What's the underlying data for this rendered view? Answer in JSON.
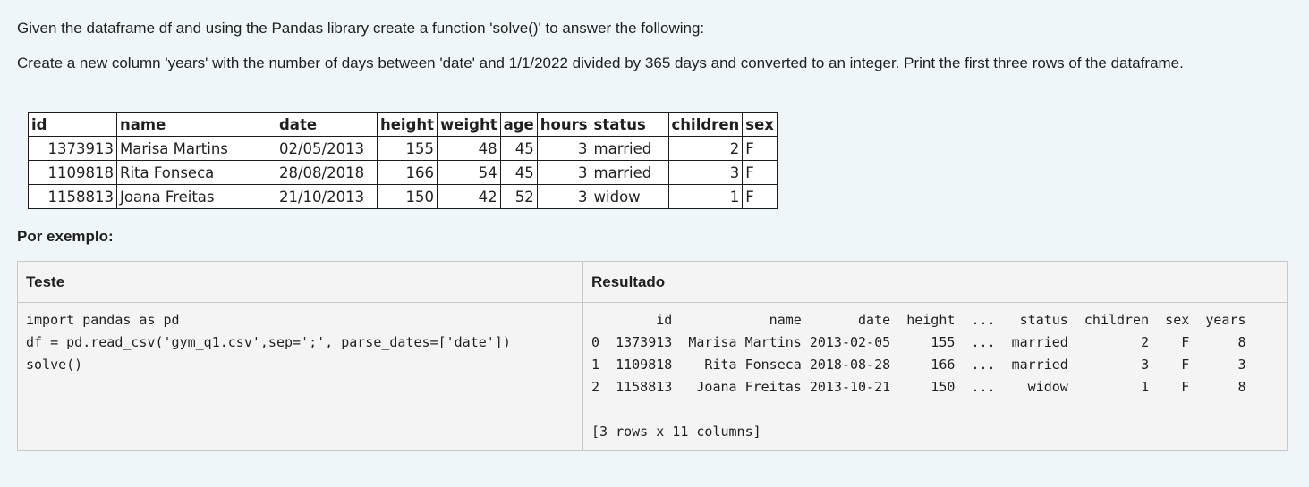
{
  "question": {
    "line1": "Given the dataframe df and using the Pandas library create a function 'solve()' to answer the following:",
    "line2": "Create a new column 'years' with the number of days between 'date' and 1/1/2022 divided by 365 days and converted to an integer. Print the first three rows of the dataframe."
  },
  "dataframe": {
    "headers": [
      "id",
      "name",
      "date",
      "height",
      "weight",
      "age",
      "hours",
      "status",
      "children",
      "sex"
    ],
    "rows": [
      [
        "1373913",
        "Marisa Martins",
        "02/05/2013",
        "155",
        "48",
        "45",
        "3",
        "married",
        "2",
        "F"
      ],
      [
        "1109818",
        "Rita Fonseca",
        "28/08/2018",
        "166",
        "54",
        "45",
        "3",
        "married",
        "3",
        "F"
      ],
      [
        "1158813",
        "Joana Freitas",
        "21/10/2013",
        "150",
        "42",
        "52",
        "3",
        "widow",
        "1",
        "F"
      ]
    ]
  },
  "example": {
    "label": "Por exemplo:",
    "test_header": "Teste",
    "result_header": "Resultado",
    "test_code": "import pandas as pd\ndf = pd.read_csv('gym_q1.csv',sep=';', parse_dates=['date'])\nsolve()",
    "result_output": "        id            name       date  height  ...   status  children  sex  years\n0  1373913  Marisa Martins 2013-02-05     155  ...  married         2    F      8\n1  1109818    Rita Fonseca 2018-08-28     166  ...  married         3    F      3\n2  1158813   Joana Freitas 2013-10-21     150  ...    widow         1    F      8\n\n[3 rows x 11 columns]"
  }
}
